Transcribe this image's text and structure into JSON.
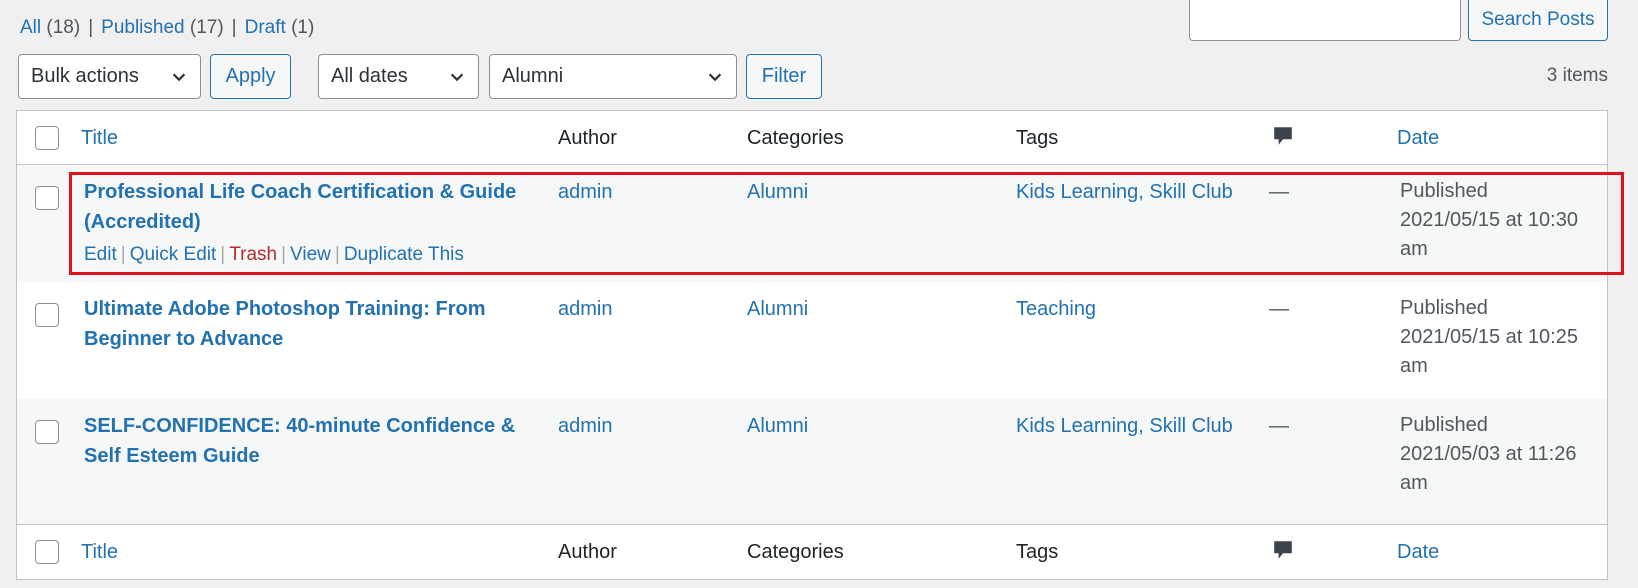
{
  "status_filter": {
    "all_label": "All",
    "all_count": "(18)",
    "published_label": "Published",
    "published_count": "(17)",
    "draft_label": "Draft",
    "draft_count": "(1)",
    "separator": "|"
  },
  "search": {
    "input_value": "",
    "button_label": "Search Posts"
  },
  "tablenav": {
    "bulk_actions_selected": "Bulk actions",
    "apply_label": "Apply",
    "dates_selected": "All dates",
    "category_selected": "Alumni",
    "filter_label": "Filter",
    "items_count": "3 items"
  },
  "columns": {
    "title": "Title",
    "author": "Author",
    "categories": "Categories",
    "tags": "Tags",
    "comments_icon": "comment-bubble-icon",
    "date": "Date"
  },
  "posts": [
    {
      "title_line1": "Professional Life Coach Certification & Guide",
      "title_line2": "(Accredited)",
      "author": "admin",
      "categories": "Alumni",
      "tags": "Kids Learning, Skill Club",
      "comments": "—",
      "date_status": "Published",
      "date_line": "2021/05/15 at 10:30",
      "date_ampm": "am",
      "actions": {
        "edit": "Edit",
        "quick_edit": "Quick Edit",
        "trash": "Trash",
        "view": "View",
        "duplicate": "Duplicate This"
      }
    },
    {
      "title_line1": "Ultimate Adobe Photoshop Training: From",
      "title_line2": "Beginner to Advance",
      "author": "admin",
      "categories": "Alumni",
      "tags": "Teaching",
      "comments": "—",
      "date_status": "Published",
      "date_line": "2021/05/15 at 10:25",
      "date_ampm": "am"
    },
    {
      "title_line1": "SELF-CONFIDENCE: 40-minute Confidence &",
      "title_line2": "Self Esteem Guide",
      "author": "admin",
      "categories": "Alumni",
      "tags": "Kids Learning, Skill Club",
      "comments": "—",
      "date_status": "Published",
      "date_line": "2021/05/03 at 11:26",
      "date_ampm": "am"
    }
  ],
  "colors": {
    "link": "#2271b1",
    "trash": "#b32d2e",
    "highlight": "#e0101c",
    "background": "#f0f0f1"
  }
}
